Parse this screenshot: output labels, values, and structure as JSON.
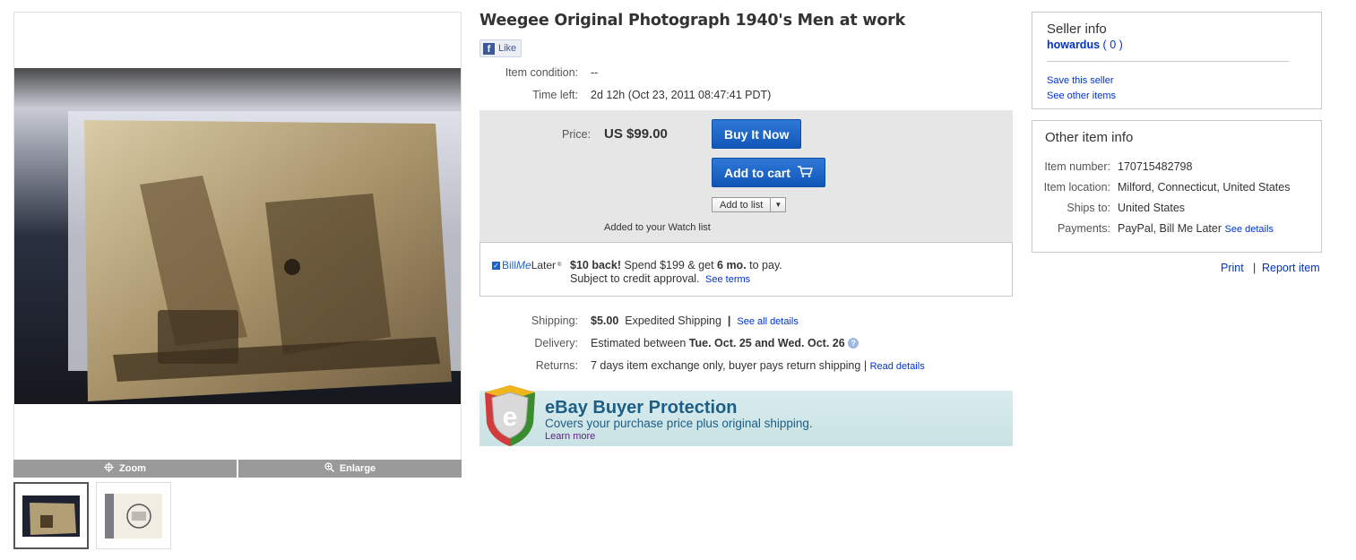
{
  "listing": {
    "title": "Weegee Original Photograph 1940's Men at work"
  },
  "social": {
    "like_label": "Like"
  },
  "details": {
    "condition_label": "Item condition:",
    "condition_value": "--",
    "time_left_label": "Time left:",
    "time_left_value": "2d 12h (Oct 23, 2011 08:47:41 PDT)"
  },
  "purchase": {
    "price_label": "Price:",
    "price_value": "US $99.00",
    "buy_now_label": "Buy It Now",
    "add_to_cart_label": "Add to cart",
    "add_to_list_label": "Add to list",
    "watch_msg": "Added to your Watch list"
  },
  "billmelater": {
    "logo_bill": "Bill",
    "logo_me": "Me",
    "logo_later": "Later",
    "trademark": "®",
    "offer_bold": "$10 back!",
    "offer_mid": " Spend $199 & get ",
    "offer_bold2": "6 mo.",
    "offer_end": " to pay.",
    "line2": "Subject to credit approval.",
    "see_terms": "See terms"
  },
  "shipping": {
    "shipping_label": "Shipping:",
    "shipping_price": "$5.00",
    "shipping_method": "Expedited Shipping",
    "separator": "|",
    "see_all": "See all details",
    "delivery_label": "Delivery:",
    "delivery_pre": "Estimated between ",
    "delivery_dates": "Tue. Oct. 25 and Wed. Oct. 26",
    "returns_label": "Returns:",
    "returns_value": "7 days item exchange only, buyer pays return shipping",
    "read_details": "Read details"
  },
  "buyer_protection": {
    "logo_letter": "e",
    "title": "eBay Buyer Protection",
    "subtitle": "Covers your purchase price plus original shipping.",
    "learn_more": "Learn more"
  },
  "viewer": {
    "zoom_label": "Zoom",
    "enlarge_label": "Enlarge"
  },
  "seller": {
    "heading": "Seller info",
    "name": "howardus",
    "score_open": "(",
    "score": "0",
    "score_close": ")",
    "save_seller": "Save this seller",
    "see_other": "See other items"
  },
  "other_info": {
    "heading": "Other item info",
    "item_number_label": "Item number:",
    "item_number": "170715482798",
    "location_label": "Item location:",
    "location": "Milford, Connecticut, United States",
    "ships_label": "Ships to:",
    "ships": "United States",
    "payments_label": "Payments:",
    "payments": "PayPal, Bill Me Later",
    "see_details": "See details"
  },
  "utilities": {
    "print": "Print",
    "separator": "|",
    "report": "Report item"
  },
  "colors": {
    "link": "#0033cc",
    "button_blue": "#1c63c8",
    "price_bg": "#e6e6e6",
    "protection_text": "#1c5e86"
  },
  "icons": [
    "facebook-icon",
    "zoom-icon",
    "enlarge-icon",
    "cart-icon",
    "help-icon",
    "check-icon",
    "shield-icon",
    "dropdown-arrow-icon"
  ]
}
